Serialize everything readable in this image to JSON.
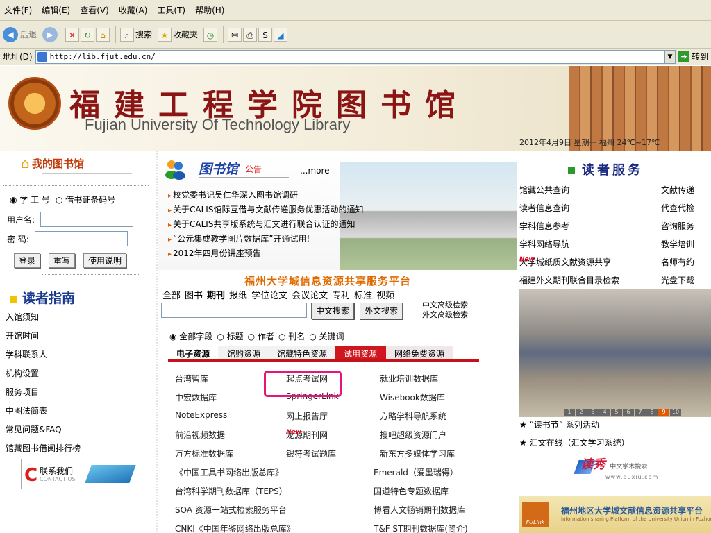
{
  "menubar": [
    "文件(F)",
    "编辑(E)",
    "查看(V)",
    "收藏(A)",
    "工具(T)",
    "帮助(H)"
  ],
  "toolbar": {
    "back": "后退",
    "search": "搜索",
    "favorites": "收藏夹"
  },
  "address": {
    "label": "地址(D)",
    "url": "http://lib.fjut.edu.cn/",
    "go": "转到"
  },
  "banner": {
    "title_cn": "福建工程学院图书馆",
    "title_en": "Fujian University Of Technology Library",
    "date_weather": "2012年4月9日 星期一  福州  24℃~17℃"
  },
  "my_library": {
    "title": "我的图书馆",
    "radio_student_id": "学 工 号",
    "radio_card_id": "借书证条码号",
    "username_label": "用户名:",
    "password_label": "密  码:",
    "login": "登录",
    "reset": "重写",
    "help": "使用说明"
  },
  "reader_guide": {
    "title": "读者指南",
    "items": [
      "入馆须知",
      "开馆时间",
      "学科联系人",
      "机构设置",
      "服务项目",
      "中图法简表",
      "常见问题&FAQ",
      "馆藏图书借阅排行榜"
    ]
  },
  "contact": {
    "cn": "联系我们",
    "en": "CONTACT US"
  },
  "notice": {
    "title": "图书馆",
    "subtitle": "公告",
    "more": "...more",
    "items": [
      "校党委书记吴仁华深入图书馆调研",
      "关于CALIS馆际互借与文献传递服务优惠活动的通知",
      "关于CALIS共享版系统与汇文进行联合认证的通知",
      "“公元集成教学图片数据库”开通试用!",
      "2012年四月份讲座预告"
    ]
  },
  "search": {
    "platform_title": "福州大学城信息资源共享服务平台",
    "tabs": [
      "全部",
      "图书",
      "期刊",
      "报纸",
      "学位论文",
      "会议论文",
      "专利",
      "标准",
      "视频"
    ],
    "selected_tab": "期刊",
    "input_value": "",
    "btn_cn": "中文搜索",
    "btn_foreign": "外文搜索",
    "adv_cn": "中文高级检索",
    "adv_foreign": "外文高级检索",
    "fields": [
      "全部字段",
      "标题",
      "作者",
      "刊名",
      "关键词"
    ]
  },
  "resource_tabs": [
    "电子资源",
    "馆购资源",
    "馆藏特色资源",
    "试用资源",
    "网络免费资源"
  ],
  "databases": [
    [
      "台湾智库",
      "起点考试网",
      "就业培训数据库"
    ],
    [
      "中宏数据库",
      "SpringerLink",
      "Wisebook数据库"
    ],
    [
      "NoteExpress",
      "网上报告厅",
      "方略学科导航系统"
    ],
    [
      "前沿视频数据",
      "龙源期刊网",
      "搜吧超级资源门户"
    ],
    [
      "万方标准数据库",
      "银符考试题库",
      "新东方多媒体学习库"
    ],
    [
      "《中国工具书网络出版总库》",
      "",
      "Emerald（爱墨瑞得）"
    ],
    [
      "台湾科学期刊数据库（TEPS）",
      "",
      "国道特色专题数据库"
    ],
    [
      "SOA 资源一站式检索服务平台",
      "",
      "博看人文畅销期刊数据库"
    ],
    [
      "CNKI《中国年鉴网络出版总库》",
      "",
      "T&F ST期刊数据库(简介)"
    ]
  ],
  "new_badge": "New",
  "reader_service": {
    "title": "读者服务",
    "rows": [
      [
        "馆藏公共查询",
        "文献传递"
      ],
      [
        "读者信息查询",
        "代查代检"
      ],
      [
        "学科信息参考",
        "咨询服务"
      ],
      [
        "学科网络导航",
        "教学培训"
      ],
      [
        "大学城纸质文献资源共享",
        "名师有约"
      ],
      [
        "福建外文期刊联合目录检索",
        "光盘下载"
      ]
    ]
  },
  "photo_pager": [
    "1",
    "2",
    "3",
    "4",
    "5",
    "6",
    "7",
    "8",
    "9",
    "10"
  ],
  "photo_pager_active": "9",
  "events": [
    "★ “读书节” 系列活动",
    "★ 汇文在线（汇文学习系统）"
  ],
  "duxiu": {
    "name": "读秀",
    "sub": "中文学术搜索",
    "url": "www.duxiu.com"
  },
  "fulink": {
    "logo": "FULink",
    "title": "福州地区大学城文献信息资源共享平台",
    "sub": "Information sharing Platform of the University Union in Fuzhou"
  }
}
